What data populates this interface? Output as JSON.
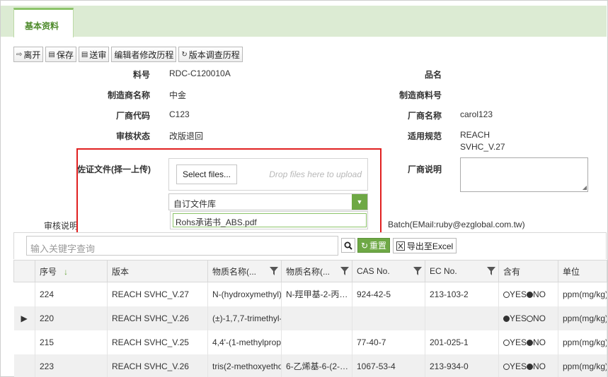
{
  "tab": {
    "label": "基本资料"
  },
  "toolbar": [
    {
      "icon": "exit-icon",
      "glyph": "⇨",
      "label": "离开"
    },
    {
      "icon": "save-icon",
      "glyph": "▤",
      "label": "保存"
    },
    {
      "icon": "send-icon",
      "glyph": "▤",
      "label": "送审"
    },
    {
      "icon": "",
      "glyph": "",
      "label": "编辑者修改历程"
    },
    {
      "icon": "history-icon",
      "glyph": "↻",
      "label": "版本调查历程"
    }
  ],
  "form": {
    "part_no": {
      "label": "料号",
      "value": "RDC-C120010A"
    },
    "product_name": {
      "label": "品名",
      "value": ""
    },
    "manufacturer": {
      "label": "制造商名称",
      "value": "中金"
    },
    "manufacturer_part": {
      "label": "制造商料号",
      "value": ""
    },
    "vendor_code": {
      "label": "厂商代码",
      "value": "C123"
    },
    "vendor_name": {
      "label": "厂商名称",
      "value": "carol123"
    },
    "review_status": {
      "label": "审核状态",
      "value": "改版退回"
    },
    "spec": {
      "label": "适用规范",
      "value_line1": "REACH",
      "value_line2": "SVHC_V.27"
    },
    "evidence": {
      "label": "佐证文件(择一上传)"
    },
    "vendor_note": {
      "label": "厂商说明"
    },
    "review_note": {
      "label": "审核说明"
    },
    "batch_text": "Batch(EMail:ruby@ezglobal.com.tw)"
  },
  "upload": {
    "select_label": "Select files...",
    "drop_hint": "Drop files here to upload",
    "combo_value": "自订文件库",
    "dropdown_item": "Rohs承诺书_ABS.pdf"
  },
  "grid_toolbar": {
    "search_placeholder": "输入关键字查询",
    "reset_label": "重置",
    "export_label": "导出至Excel"
  },
  "grid": {
    "columns": [
      "",
      "序号",
      "版本",
      "物质名称(...",
      "物质名称(...",
      "CAS No.",
      "EC No.",
      "含有",
      "单位"
    ],
    "rows": [
      {
        "marker": "",
        "seq": "224",
        "version": "REACH SVHC_V.27",
        "name_en": "N-(hydroxymethyl)",
        "name_cn": "N-羥甲基-2-丙…",
        "cas": "924-42-5",
        "ec": "213-103-2",
        "contains": "NO",
        "unit": "ppm(mg/kg)"
      },
      {
        "marker": "▶",
        "seq": "220",
        "version": "REACH SVHC_V.26",
        "name_en": "(±)-1,7,7-trimethyl-",
        "name_cn": "",
        "cas": "",
        "ec": "",
        "contains": "YES",
        "unit": "ppm(mg/kg)"
      },
      {
        "marker": "",
        "seq": "215",
        "version": "REACH SVHC_V.25",
        "name_en": "4,4'-(1-methylprop",
        "name_cn": "",
        "cas": "77-40-7",
        "ec": "201-025-1",
        "contains": "NO",
        "unit": "ppm(mg/kg)"
      },
      {
        "marker": "",
        "seq": "223",
        "version": "REACH SVHC_V.26",
        "name_en": "tris(2-methoxyetho",
        "name_cn": "6-乙烯基-6-(2-…",
        "cas": "1067-53-4",
        "ec": "213-934-0",
        "contains": "NO",
        "unit": "ppm(mg/kg)"
      }
    ],
    "yes_label": "YES",
    "no_label": "NO"
  }
}
